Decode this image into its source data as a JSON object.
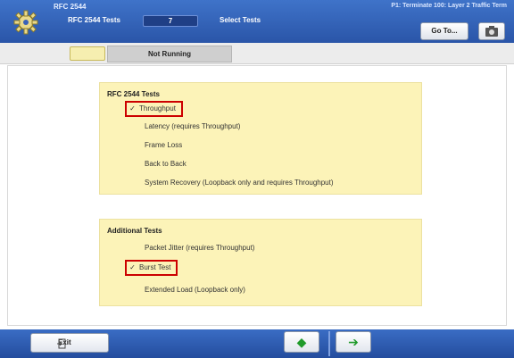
{
  "header": {
    "title": "RFC 2544",
    "subtitle": "RFC 2544 Tests",
    "step_indicator": "7",
    "select_label": "Select Tests",
    "right_text": "P1: Terminate 100: Layer 2 Traffic Term",
    "goto_label": "Go To..."
  },
  "tabs": {
    "status_label": "Not Running"
  },
  "rfc_panel": {
    "title": "RFC 2544 Tests",
    "options": [
      {
        "label": "Throughput",
        "checked": true
      },
      {
        "label": "Latency (requires Throughput)",
        "checked": false
      },
      {
        "label": "Frame Loss",
        "checked": false
      },
      {
        "label": "Back to Back",
        "checked": false
      },
      {
        "label": "System Recovery (Loopback only and requires Throughput)",
        "checked": false
      }
    ]
  },
  "additional_panel": {
    "title": "Additional Tests",
    "options": [
      {
        "label": "Packet Jitter (requires Throughput)",
        "checked": false
      },
      {
        "label": "Burst Test",
        "checked": true
      },
      {
        "label": "Extended Load (Loopback only)",
        "checked": false
      }
    ]
  },
  "footer": {
    "exit_label": "Exit",
    "back_arrow": "◆",
    "next_arrow": "➔"
  },
  "colors": {
    "header_blue": "#2f5fb7",
    "panel_yellow": "#fcf3b8",
    "highlight_red": "#cc0000",
    "arrow_green": "#1f9a2a"
  },
  "icons": {
    "app": "gear-icon",
    "camera": "camera-icon",
    "exit": "exit-door-icon",
    "back": "back-arrow-icon",
    "next": "next-arrow-icon"
  }
}
